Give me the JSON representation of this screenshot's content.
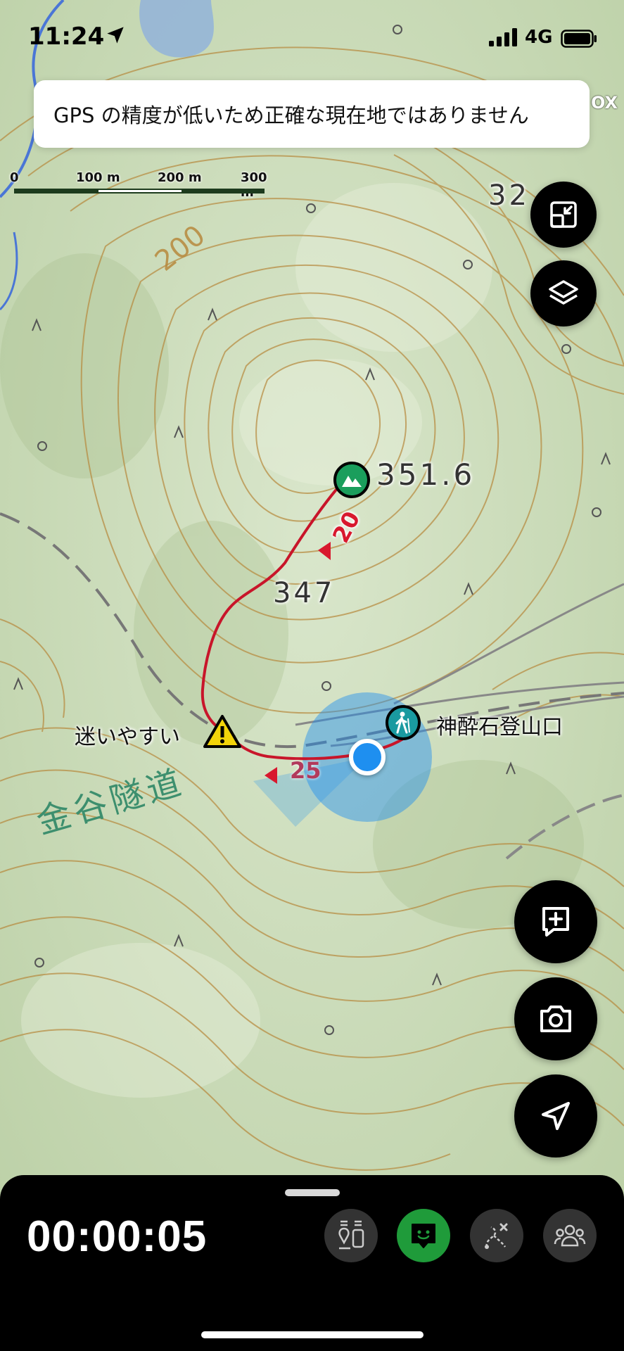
{
  "status_bar": {
    "time": "11:24",
    "network": "4G"
  },
  "toast": {
    "message": "GPS の精度が低いため正確な現在地ではありません"
  },
  "scale_bar": {
    "labels": [
      "0",
      "100 m",
      "200 m",
      "300 m"
    ]
  },
  "map": {
    "contour_labels": [
      "200"
    ],
    "spot_heights": [
      "351.6",
      "347",
      "32"
    ],
    "place_labels": [
      "金谷隧道"
    ],
    "edge_text": "OX",
    "markers": {
      "summit": {
        "icon": "mountain-icon",
        "color": "#1a9e5c"
      },
      "trailhead": {
        "icon": "hiker-icon",
        "label": "神酔石登山口",
        "color": "#1a9aa0"
      },
      "warning": {
        "icon": "warning-icon",
        "label": "迷いやすい",
        "color": "#f2d40a"
      },
      "current_location": {
        "color": "#1e8ff0"
      }
    },
    "route_times": [
      {
        "minutes": "20",
        "color": "#d8182e"
      },
      {
        "minutes": "25",
        "color": "#d8182e"
      }
    ],
    "route_color": "#c8152a"
  },
  "side_buttons": {
    "top": [
      {
        "icon": "expand-map-icon"
      },
      {
        "icon": "layers-icon"
      }
    ],
    "bottom": [
      {
        "icon": "add-memo-icon"
      },
      {
        "icon": "camera-icon"
      },
      {
        "icon": "navigate-arrow-icon"
      }
    ]
  },
  "bottom_panel": {
    "elapsed_time": "00:00:05",
    "tools": [
      {
        "icon": "elevation-list-icon",
        "active": false
      },
      {
        "icon": "chat-face-icon",
        "active": true
      },
      {
        "icon": "route-plan-icon",
        "active": false
      },
      {
        "icon": "group-icon",
        "active": false
      }
    ]
  }
}
